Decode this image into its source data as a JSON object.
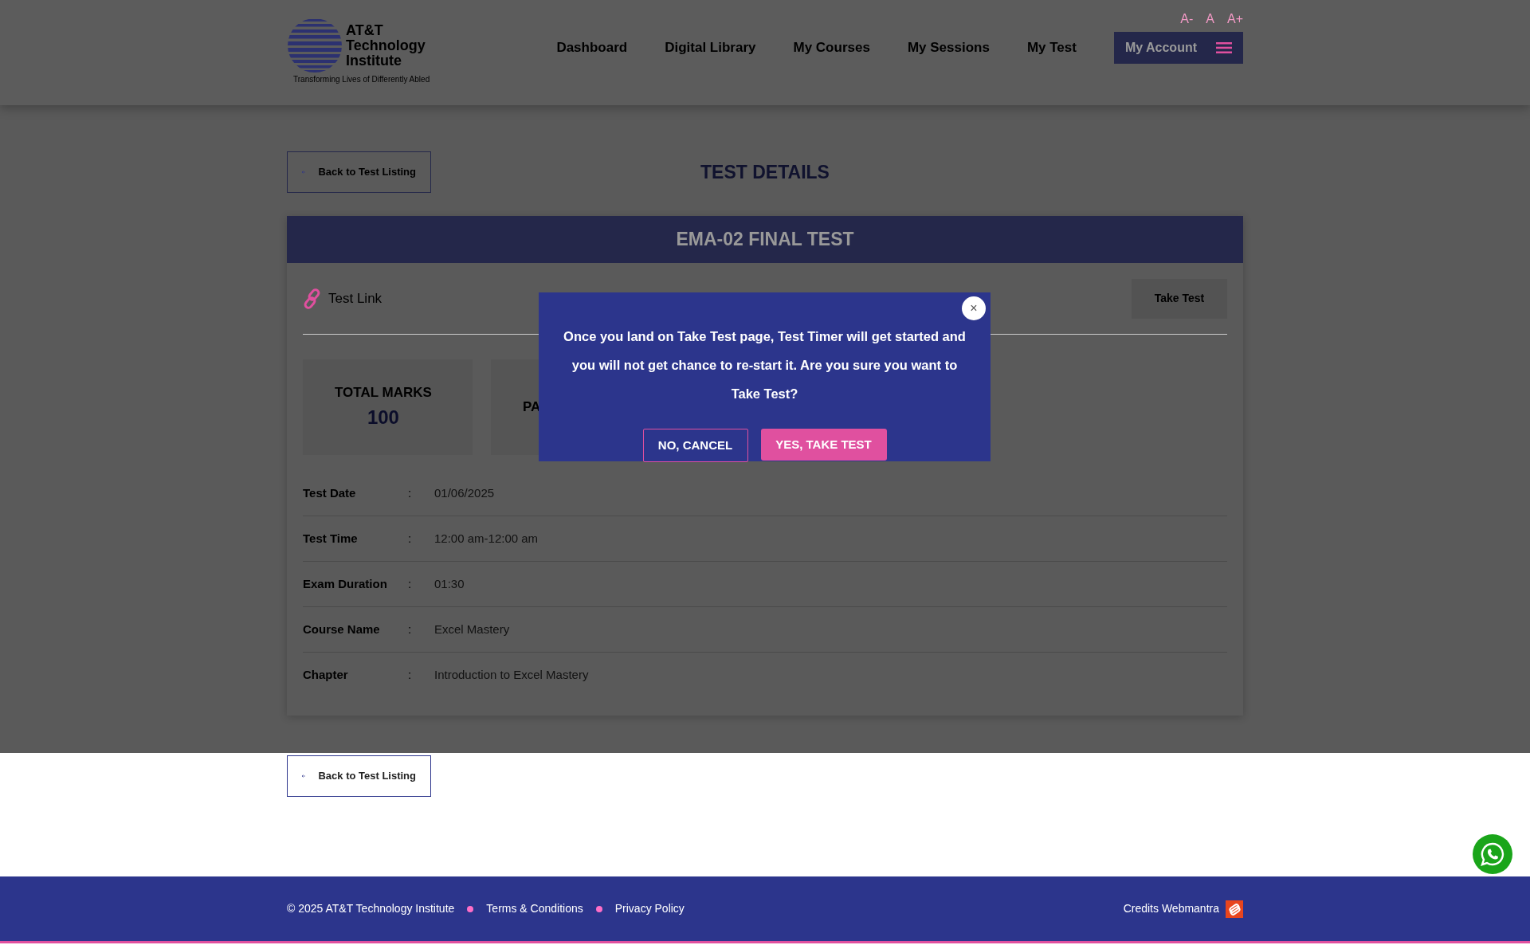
{
  "header": {
    "logo_lines": [
      "AT&T",
      "Technology",
      "Institute"
    ],
    "tagline": "Transforming Lives of Differently Abled",
    "font_size_controls": [
      "A-",
      "A",
      "A+"
    ],
    "nav": [
      "Dashboard",
      "Digital Library",
      "My Courses",
      "My Sessions",
      "My Test"
    ],
    "account_button": "My Account"
  },
  "back_button": "Back to Test Listing",
  "page_title": "TEST DETAILS",
  "test": {
    "title": "EMA-02 FINAL TEST",
    "link_label": "Test Link",
    "take_test_button": "Take Test",
    "stats": [
      {
        "label": "TOTAL MARKS",
        "value": "100"
      },
      {
        "label": "PA"
      }
    ],
    "details": [
      {
        "label": "Test Date",
        "separator": ":",
        "value": "01/06/2025"
      },
      {
        "label": "Test Time",
        "separator": ":",
        "value": "12:00 am-12:00 am"
      },
      {
        "label": "Exam Duration",
        "separator": ":",
        "value": "01:30"
      },
      {
        "label": "Course Name",
        "separator": ":",
        "value": "Excel Mastery"
      },
      {
        "label": "Chapter",
        "separator": ":",
        "value": "Introduction to Excel Mastery"
      }
    ]
  },
  "modal": {
    "close": "×",
    "message": "Once you land on Take Test page, Test Timer will get started and you will not get chance to re-start it. Are you sure you want to Take Test?",
    "cancel_button": "NO, CANCEL",
    "confirm_button": "YES, TAKE TEST"
  },
  "bottom_back_button": "Back to Test Listing",
  "footer": {
    "copyright": "© 2025 AT&T Technology Institute",
    "links": [
      "Terms & Conditions",
      "Privacy Policy"
    ],
    "credits": "Credits Webmantra"
  }
}
